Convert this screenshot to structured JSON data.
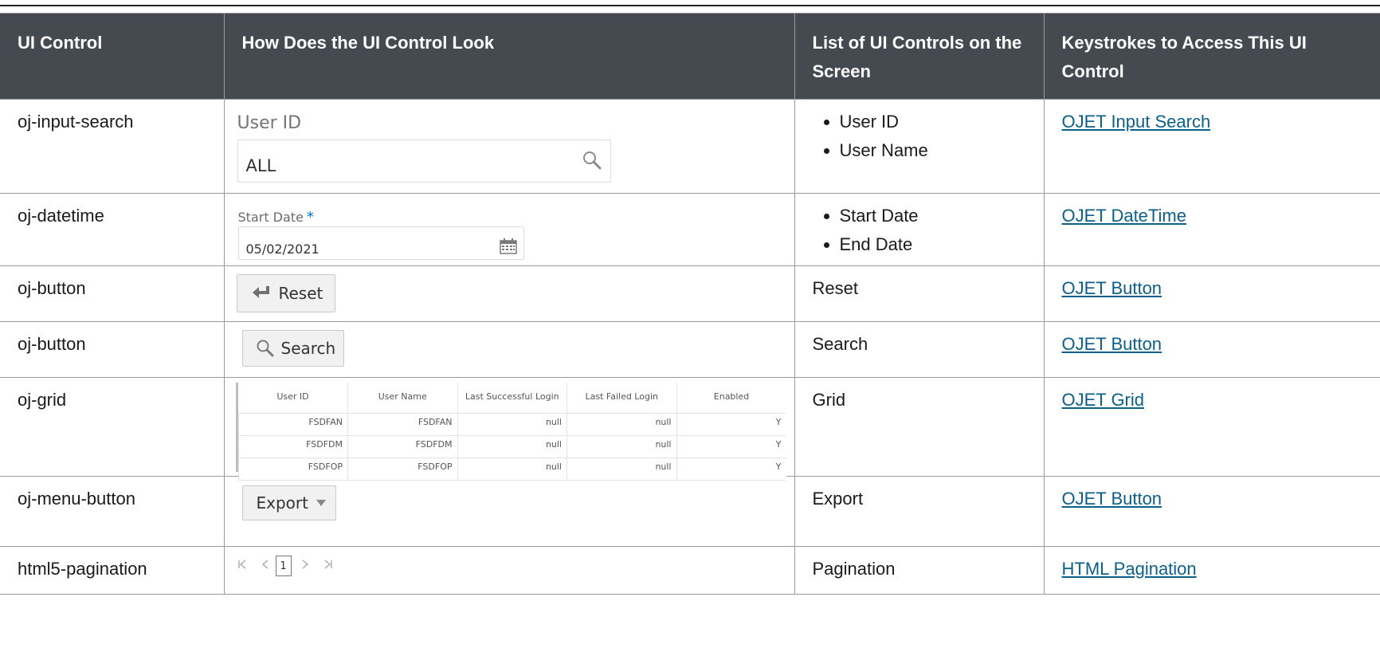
{
  "headers": {
    "col1": "UI Control",
    "col2": "How Does the UI Control Look",
    "col3": "List of UI Controls on the Screen",
    "col4": "Keystrokes to Access This UI Control"
  },
  "rows": [
    {
      "control": "oj-input-search",
      "controls_on_screen": [
        "User ID",
        "User Name"
      ],
      "keystroke_link": "OJET Input Search",
      "preview": {
        "label": "User ID",
        "value": "ALL",
        "icon": "search-icon"
      }
    },
    {
      "control": "oj-datetime",
      "controls_on_screen": [
        "Start Date",
        "End Date"
      ],
      "keystroke_link": " OJET DateTime",
      "preview": {
        "label": "Start Date",
        "required_mark": "*",
        "value": "05/02/2021",
        "icon": "calendar-icon"
      }
    },
    {
      "control": "oj-button",
      "controls_on_screen_text": "Reset",
      "keystroke_link": "OJET Button",
      "preview": {
        "label": "Reset",
        "icon": "reset-arrow-icon"
      }
    },
    {
      "control": "oj-button",
      "controls_on_screen_text": "Search",
      "keystroke_link": "OJET Button",
      "preview": {
        "label": "Search",
        "icon": "search-icon"
      }
    },
    {
      "control": "oj-grid",
      "controls_on_screen_text": "Grid",
      "keystroke_link": "OJET Grid",
      "preview": {
        "columns": [
          "User ID",
          "User Name",
          "Last Successful Login",
          "Last Failed Login",
          "Enabled"
        ],
        "rows": [
          [
            "FSDFAN",
            "FSDFAN",
            "null",
            "null",
            "Y"
          ],
          [
            "FSDFDM",
            "FSDFDM",
            "null",
            "null",
            "Y"
          ],
          [
            "FSDFOP",
            "FSDFOP",
            "null",
            "null",
            "Y"
          ]
        ]
      }
    },
    {
      "control": "oj-menu-button",
      "controls_on_screen_text": "Export",
      "keystroke_link": "OJET Button",
      "preview": {
        "label": "Export",
        "icon": "caret-down-icon"
      }
    },
    {
      "control": "html5-pagination",
      "controls_on_screen_text": "Pagination",
      "keystroke_link": "HTML Pagination",
      "preview": {
        "current_page": "1",
        "icons": [
          "first-page-icon",
          "prev-page-icon",
          "next-page-icon",
          "last-page-icon"
        ]
      }
    }
  ],
  "colors": {
    "header_bg": "#444a50",
    "link": "#0b5f8a",
    "required": "#0572ce"
  }
}
